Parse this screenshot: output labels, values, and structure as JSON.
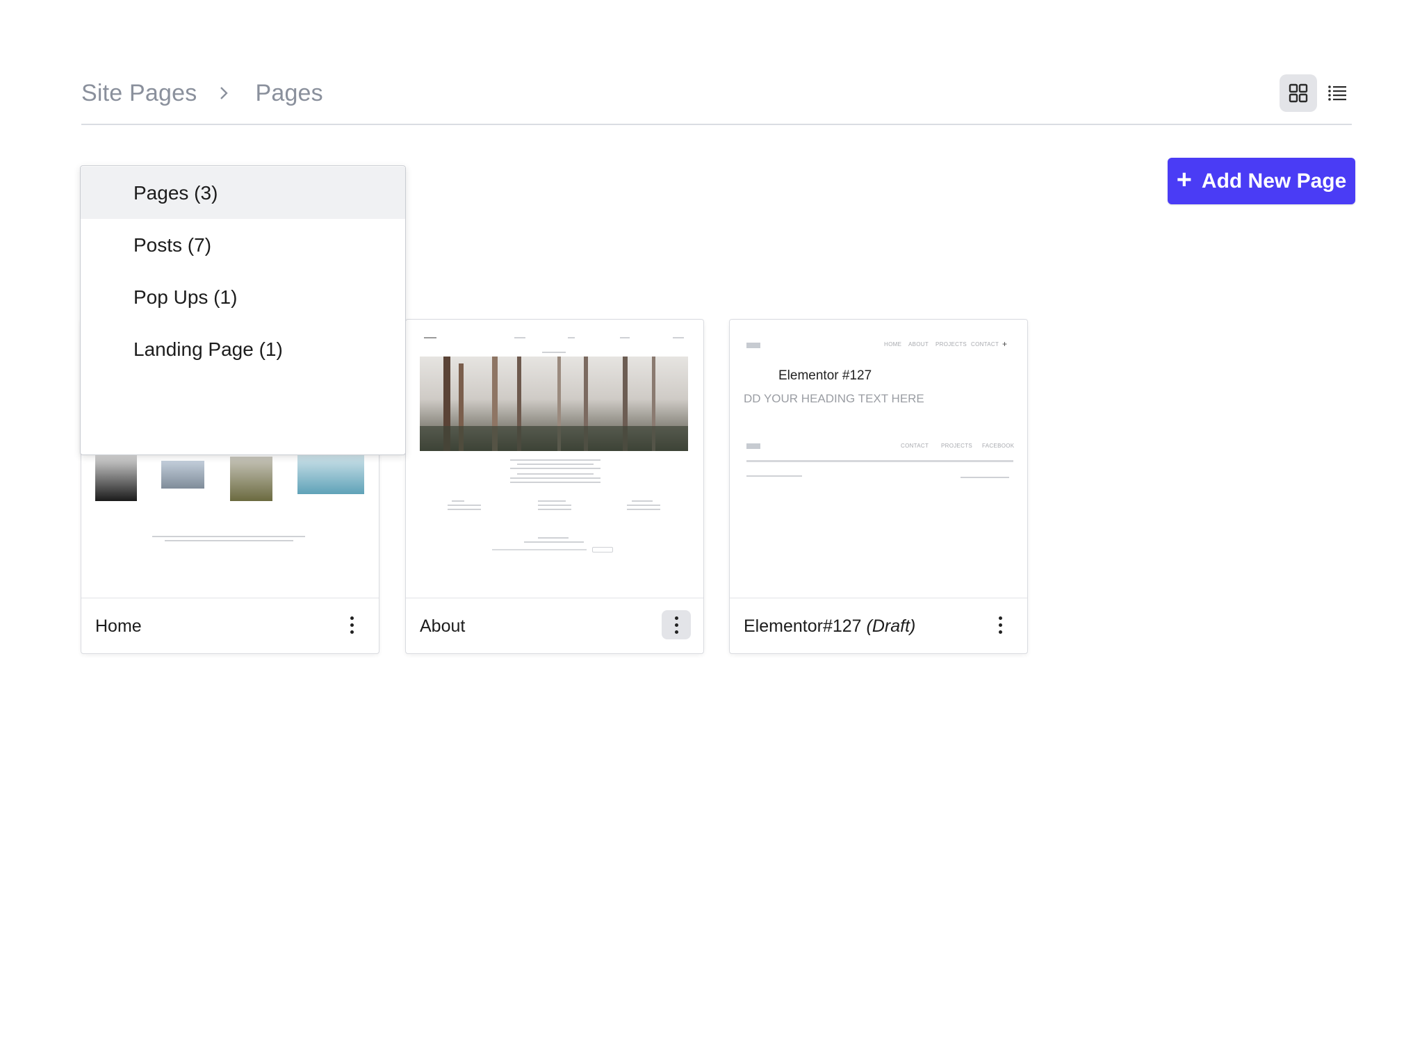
{
  "breadcrumb": {
    "root": "Site Pages",
    "current": "Pages"
  },
  "view_toggle": {
    "grid_icon": "grid-icon",
    "list_icon": "list-icon",
    "active": "grid"
  },
  "add_button": {
    "label": "Add New Page",
    "icon": "plus-icon",
    "color": "#4a3cf5"
  },
  "dropdown": {
    "items": [
      {
        "label": "Pages (3)",
        "selected": true
      },
      {
        "label": "Posts (7)",
        "selected": false
      },
      {
        "label": "Pop Ups (1)",
        "selected": false
      },
      {
        "label": "Landing Page (1)",
        "selected": false
      }
    ]
  },
  "cards": [
    {
      "title": "Home",
      "status": ""
    },
    {
      "title": "About",
      "status": ""
    },
    {
      "title": "Elementor#127",
      "status": "(Draft)"
    }
  ],
  "thumb3": {
    "heading": "Elementor #127",
    "subheading": "DD YOUR HEADING TEXT HERE",
    "nav": [
      "HOME",
      "ABOUT",
      "PROJECTS",
      "CONTACT"
    ],
    "footer_nav": [
      "CONTACT",
      "PROJECTS",
      "FACEBOOK"
    ]
  }
}
